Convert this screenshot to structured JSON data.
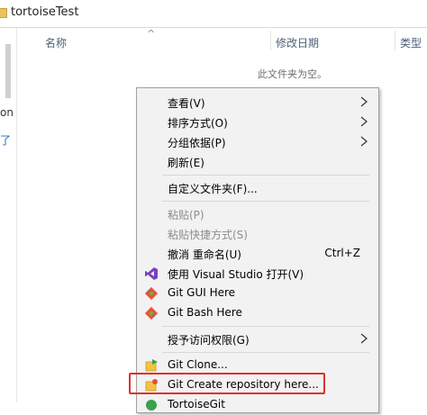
{
  "window": {
    "title": "tortoiseTest"
  },
  "nav": {
    "partial_1": "on",
    "partial_2": "了"
  },
  "columns": {
    "name": "名称",
    "date": "修改日期",
    "type": "类型"
  },
  "sort_indicator": "^",
  "empty_message": "此文件夹为空。",
  "context_menu": {
    "view": "查看(V)",
    "sort_by": "排序方式(O)",
    "group_by": "分组依据(P)",
    "refresh": "刷新(E)",
    "customize_folder": "自定义文件夹(F)...",
    "paste": "粘贴(P)",
    "paste_shortcut": "粘贴快捷方式(S)",
    "undo_rename": "撤消 重命名(U)",
    "undo_shortcut": "Ctrl+Z",
    "open_vs": "使用 Visual Studio 打开(V)",
    "git_gui": "Git GUI Here",
    "git_bash": "Git Bash Here",
    "grant_access": "授予访问权限(G)",
    "git_clone": "Git Clone...",
    "git_create_repo": "Git Create repository here...",
    "tortoisegit": "TortoiseGit"
  },
  "colors": {
    "highlight_border": "#e42e2e",
    "vs_purple": "#7b3fbf",
    "git_orange": "#f05033"
  }
}
